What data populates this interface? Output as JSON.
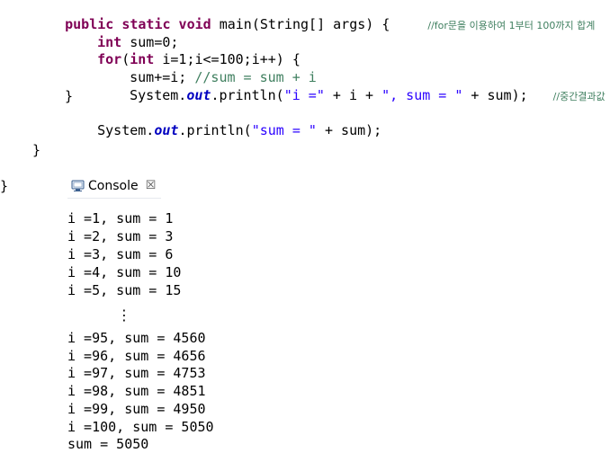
{
  "editor": {
    "line_main": {
      "kw": "public static void",
      "sig": " main(String[] args) {",
      "comment": "//for문을 이용하여 1부터 100까지 합계"
    },
    "line_int": {
      "kw": "int",
      "rest": " sum=0;"
    },
    "line_for": {
      "kw_for": "for",
      "open": "(",
      "kw_int": "int",
      "rest": " i=1;i<=100;i++) {"
    },
    "line_sum": {
      "code": "sum+=i; ",
      "comment": "//sum = sum + i"
    },
    "line_print1": {
      "pre": "System.",
      "field": "out",
      "mid": ".println(",
      "s1": "\"i =\"",
      "mid2": " + i + ",
      "s2": "\", sum = \"",
      "end": " + sum);",
      "comment": "//중간결과값"
    },
    "line_close_for": "}",
    "line_print2": {
      "pre": "System.",
      "field": "out",
      "mid": ".println(",
      "s1": "\"sum = \"",
      "end": " + sum);"
    },
    "line_close_main": "}",
    "line_close_class": "}"
  },
  "console": {
    "tab_label": "Console",
    "close_glyph": "☒",
    "output_first": [
      "i =1, sum = 1",
      "i =2, sum = 3",
      "i =3, sum = 6",
      "i =4, sum = 10",
      "i =5, sum = 15"
    ],
    "ellipsis": "⋮",
    "output_last": [
      "i =95, sum = 4560",
      "i =96, sum = 4656",
      "i =97, sum = 4753",
      "i =98, sum = 4851",
      "i =99, sum = 4950",
      "i =100, sum = 5050",
      "sum = 5050"
    ]
  },
  "colors": {
    "keyword": "#7f0055",
    "string": "#2a00ff",
    "comment": "#3f7f5f",
    "static_field": "#0000c0"
  }
}
